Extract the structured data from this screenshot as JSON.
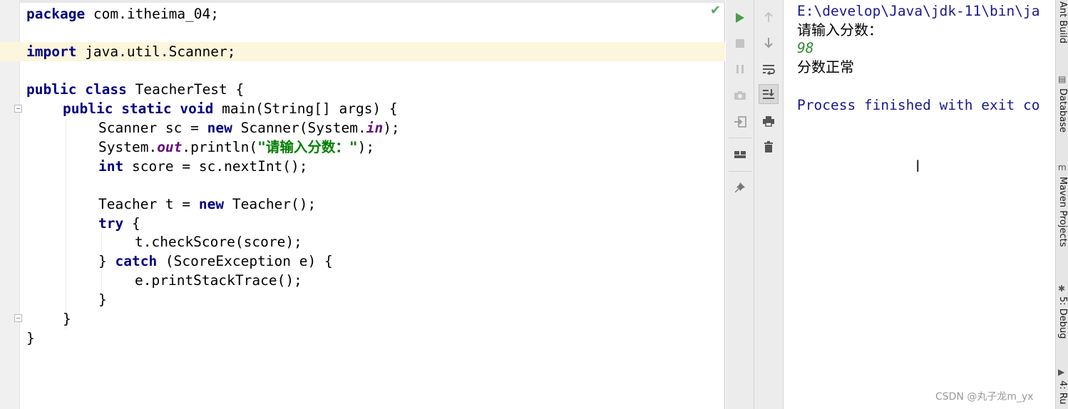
{
  "editor": {
    "package_keyword": "package",
    "package_name": " com.itheima_04;",
    "import_keyword": "import",
    "import_name": " java.util.Scanner;",
    "class_kw1": "public",
    "class_kw2": "class",
    "class_name": " TeacherTest {",
    "main_kw1": "public",
    "main_kw2": "static",
    "main_kw3": "void",
    "main_sig": " main(String[] args) {",
    "scanner_decl": "Scanner sc = ",
    "new_kw": "new",
    "scanner_ctor": " Scanner(System.",
    "in_field": "in",
    "close_paren_semi": ");",
    "system_prefix": "System.",
    "out_field": "out",
    "println_open": ".println(",
    "prompt_string": "\"请输入分数：\"",
    "int_kw": "int",
    "score_decl": " score = sc.nextInt();",
    "teacher_decl": "Teacher t = ",
    "teacher_ctor": " Teacher();",
    "try_kw": "try",
    "try_open": " {",
    "check_call": "t.checkScore(score);",
    "close_brace_prefix": "} ",
    "catch_kw": "catch",
    "catch_rest": " (ScoreException e) {",
    "print_trace": "e.printStackTrace();",
    "close_brace": "}",
    "inspection_ok_icon": "check-icon"
  },
  "run_toolbar": {
    "rerun_icon": "play-icon",
    "stop_icon": "stop-icon",
    "pause_icon": "pause-icon",
    "snapshot_icon": "camera-icon",
    "login_icon": "enter-icon",
    "layout_icon": "layout-icon",
    "pin_icon": "pin-icon"
  },
  "console_toolbar": {
    "up_icon": "arrow-up-icon",
    "down_icon": "arrow-down-icon",
    "wrap_icon": "soft-wrap-icon",
    "scroll_end_icon": "scroll-to-end-icon",
    "print_icon": "print-icon",
    "clear_icon": "trash-icon"
  },
  "console": {
    "command_line": "E:\\develop\\Java\\jdk-11\\bin\\ja",
    "prompt_output": "请输入分数：",
    "user_input": "98",
    "result_output": "分数正常",
    "process_line": "Process finished with exit co"
  },
  "side_tabs": {
    "ant_build": "Ant Build",
    "database": "Database",
    "maven_projects": "Maven Projects",
    "debug": "5: Debug",
    "run": "4: Ru"
  },
  "watermark": "CSDN @丸子龙m_yx"
}
